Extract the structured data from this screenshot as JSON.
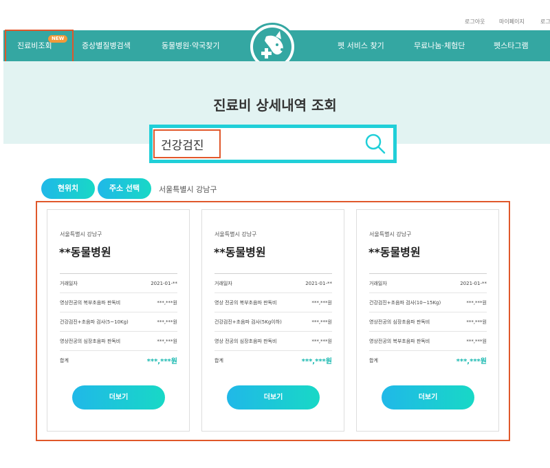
{
  "utility": {
    "logout": "로그아웃",
    "mypage": "마이페이지",
    "more": "로그"
  },
  "nav": {
    "items": [
      "진료비조회",
      "증상별질병검색",
      "동물병원·약국찾기",
      "펫 서비스 찾기",
      "무료나눔·체험단",
      "펫스타그램"
    ],
    "new_badge": "NEW",
    "logo_icon": "dog-medical-cross-icon"
  },
  "hero": {
    "title": "진료비 상세내역 조회"
  },
  "search": {
    "value": "건강검진",
    "icon": "search-icon"
  },
  "location": {
    "current_label": "현위치",
    "select_label": "주소 선택",
    "address": "서울특별시 강남구"
  },
  "cards": [
    {
      "region": "서울특별시 강남구",
      "name": "**동물병원",
      "rows": [
        {
          "label": "거래일자",
          "value": "2021-01-**"
        },
        {
          "label": "영상전공의 복부초음파 판독비",
          "value": "***,***원"
        },
        {
          "label": "건강검진+초음파 검사(5~10Kg)",
          "value": "***,***원"
        },
        {
          "label": "영상전공의 심장초음파 판독비",
          "value": "***,***원"
        },
        {
          "label": "합계",
          "value": "***,***원"
        }
      ],
      "more_label": "더보기"
    },
    {
      "region": "서울특별시 강남구",
      "name": "**동물병원",
      "rows": [
        {
          "label": "거래일자",
          "value": "2021-01-**"
        },
        {
          "label": "영상 전공의 복부초음파 판독비",
          "value": "***,***원"
        },
        {
          "label": "건강검진+초음파 검사(5Kg이하)",
          "value": "***,***원"
        },
        {
          "label": "영상 전공의 심장초음파 판독비",
          "value": "***,***원"
        },
        {
          "label": "합계",
          "value": "***,***원"
        }
      ],
      "more_label": "더보기"
    },
    {
      "region": "서울특별시 강남구",
      "name": "**동물병원",
      "rows": [
        {
          "label": "거래일자",
          "value": "2021-01-**"
        },
        {
          "label": "건강검진+초음파 검사(10~15Kg)",
          "value": "***,***원"
        },
        {
          "label": "영상전공의 심장초음파 판독비",
          "value": "***,***원"
        },
        {
          "label": "영상전공의 복부초음파 판독비",
          "value": "***,***원"
        },
        {
          "label": "합계",
          "value": "***,***원"
        }
      ],
      "more_label": "더보기"
    }
  ],
  "colors": {
    "teal_nav": "#34a7a2",
    "hero_bg": "#e2f3f2",
    "search_border": "#20cfd8",
    "highlight": "#e0572a",
    "badge": "#f29a3a",
    "total_text": "#18b8b0"
  }
}
